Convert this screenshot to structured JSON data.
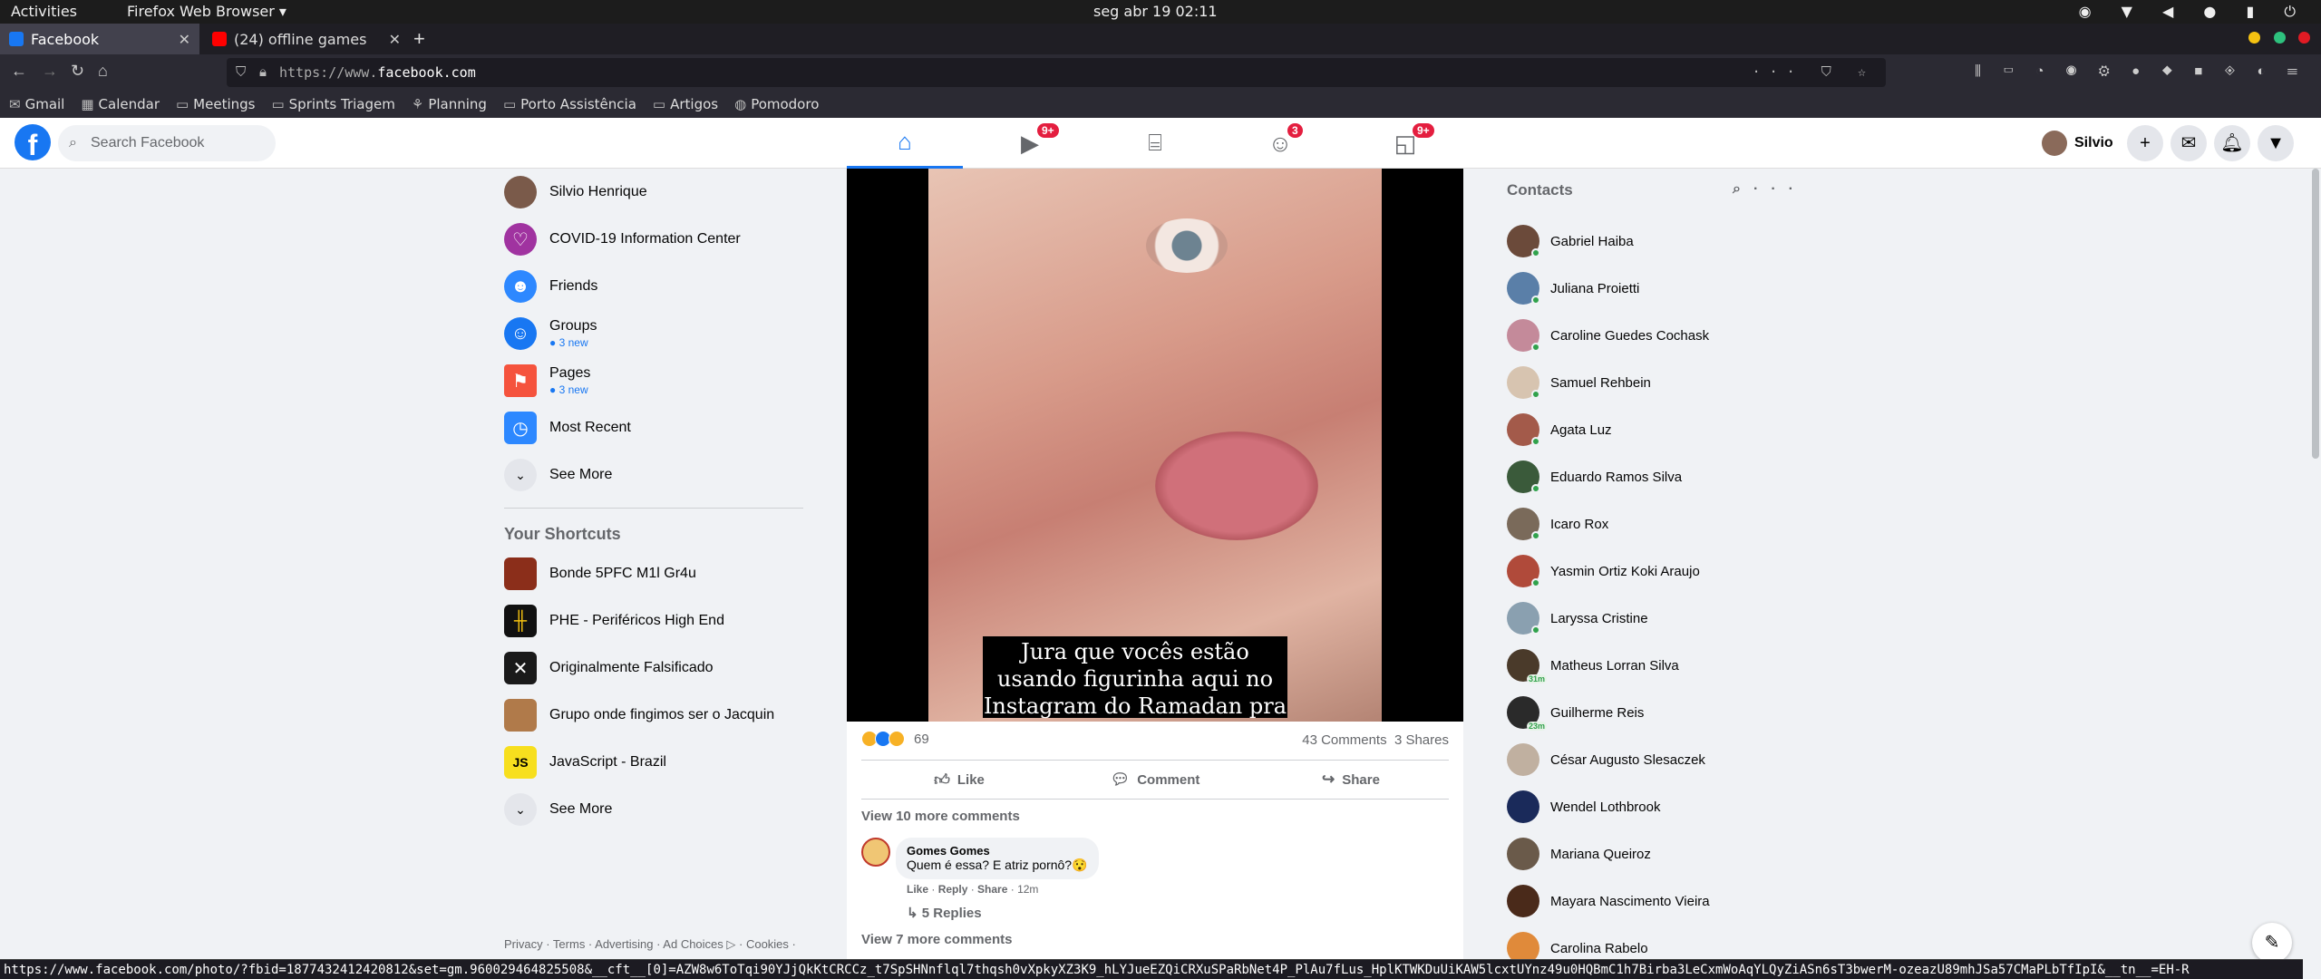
{
  "system": {
    "activities": "Activities",
    "app_menu": "Firefox Web Browser ▾",
    "clock": "seg abr 19  02:11",
    "tray_icons": [
      "record-icon",
      "wifi-icon",
      "volume-icon",
      "mic-icon",
      "battery-icon",
      "power-icon"
    ]
  },
  "browser": {
    "tabs": [
      {
        "label": "Facebook",
        "active": true,
        "favicon_color": "#1877f2"
      },
      {
        "label": "(24) offline games",
        "active": false,
        "favicon_color": "#ff0000"
      }
    ],
    "new_tab": "+",
    "url_prefix": "https://www.",
    "url_domain": "facebook.com",
    "bookmarks": [
      {
        "label": "Gmail",
        "icon": "gmail-icon"
      },
      {
        "label": "Calendar",
        "icon": "calendar-icon"
      },
      {
        "label": "Meetings",
        "icon": "folder-icon"
      },
      {
        "label": "Sprints Triagem",
        "icon": "folder-icon"
      },
      {
        "label": "Planning",
        "icon": "planning-icon"
      },
      {
        "label": "Porto Assistência",
        "icon": "folder-icon"
      },
      {
        "label": "Artigos",
        "icon": "folder-icon"
      },
      {
        "label": "Pomodoro",
        "icon": "globe-icon"
      }
    ],
    "status_url": "https://www.facebook.com/photo/?fbid=1877432412420812&set=gm.960029464825508&__cft__[0]=AZW8w6ToTqi90YJjQkKtCRCCz_t7SpSHNnflql7thqsh0vXpkyXZ3K9_hLYJueEZQiCRXuSPaRbNet4P_PlAu7fLus_HplKTWKDuUiKAW5lcxtUYnz49u0HQBmC1h7Birba3LeCxmWoAqYLQyZiASn6sT3bwerM-ozeazU89mhJSa57CMaPLbTfIpI&__tn__=EH-R"
  },
  "fb_header": {
    "search_placeholder": "Search Facebook",
    "nav": [
      {
        "name": "home",
        "icon": "home-icon",
        "badge": "",
        "active": true
      },
      {
        "name": "watch",
        "icon": "video-icon",
        "badge": "9+",
        "active": false
      },
      {
        "name": "marketplace",
        "icon": "store-icon",
        "badge": "",
        "active": false
      },
      {
        "name": "groups",
        "icon": "groups-icon",
        "badge": "3",
        "active": false
      },
      {
        "name": "gaming",
        "icon": "gaming-icon",
        "badge": "9+",
        "active": false
      }
    ],
    "profile_name": "Silvio"
  },
  "left_menu": {
    "items": [
      {
        "label": "Silvio Henrique",
        "sub": "",
        "icon": "avatar"
      },
      {
        "label": "COVID-19 Information Center",
        "sub": "",
        "icon": "covid-icon"
      },
      {
        "label": "Friends",
        "sub": "",
        "icon": "friends-icon"
      },
      {
        "label": "Groups",
        "sub": "3 new",
        "icon": "groups-icon"
      },
      {
        "label": "Pages",
        "sub": "3 new",
        "icon": "flag-icon"
      },
      {
        "label": "Most Recent",
        "sub": "",
        "icon": "clock-icon"
      },
      {
        "label": "See More",
        "sub": "",
        "icon": "chevron-down-icon"
      }
    ],
    "shortcuts_title": "Your Shortcuts",
    "shortcuts": [
      {
        "label": "Bonde 5PFC M1l Gr4u",
        "color": "#8b2e1a"
      },
      {
        "label": "PHE - Periféricos High End",
        "color": "#111111"
      },
      {
        "label": "Originalmente Falsificado",
        "color": "#1a1a1a"
      },
      {
        "label": "Grupo onde fingimos ser o Jacquin",
        "color": "#b07a4a"
      },
      {
        "label": "JavaScript - Brazil",
        "color": "#f7df1e"
      }
    ],
    "shortcuts_see_more": "See More",
    "footer": "Privacy · Terms · Advertising · Ad Choices ▷ · Cookies ·"
  },
  "post": {
    "caption": "Jura que vocês estão usando figurinha aqui no Instagram do Ramadan pra",
    "reaction_count": "69",
    "comments_count": "43 Comments",
    "shares_count": "3 Shares",
    "actions": {
      "like": "Like",
      "comment": "Comment",
      "share": "Share"
    },
    "view_more_top": "View 10 more comments",
    "comment": {
      "author": "Gomes Gomes",
      "text": "Quem é essa? E atriz pornô?😯",
      "like": "Like",
      "reply": "Reply",
      "share": "Share",
      "time": "12m",
      "replies": "5 Replies"
    },
    "view_more_bottom": "View 7 more comments"
  },
  "contacts": {
    "title": "Contacts",
    "people": [
      {
        "name": "Gabriel Haiba",
        "status": "online",
        "color": "#6b4a3a"
      },
      {
        "name": "Juliana Proietti",
        "status": "online",
        "color": "#5a7fa8"
      },
      {
        "name": "Caroline Guedes Cochask",
        "status": "online",
        "color": "#c48a9a"
      },
      {
        "name": "Samuel Rehbein",
        "status": "online",
        "color": "#d7c4b0"
      },
      {
        "name": "Agata Luz",
        "status": "online",
        "color": "#a35a4a"
      },
      {
        "name": "Eduardo Ramos Silva",
        "status": "online",
        "color": "#3a5a3a"
      },
      {
        "name": "Icaro Rox",
        "status": "online",
        "color": "#7a6a5a"
      },
      {
        "name": "Yasmin Ortiz Koki Araujo",
        "status": "online",
        "color": "#b04a3a"
      },
      {
        "name": "Laryssa Cristine",
        "status": "online",
        "color": "#8aa0b0"
      },
      {
        "name": "Matheus Lorran Silva",
        "status": "31m",
        "color": "#4a3a2a"
      },
      {
        "name": "Guilherme Reis",
        "status": "23m",
        "color": "#2a2a2a"
      },
      {
        "name": "César Augusto Slesaczek",
        "status": "",
        "color": "#c0b0a0"
      },
      {
        "name": "Wendel Lothbrook",
        "status": "",
        "color": "#1a2a5a"
      },
      {
        "name": "Mariana Queiroz",
        "status": "",
        "color": "#6a5a4a"
      },
      {
        "name": "Mayara Nascimento Vieira",
        "status": "",
        "color": "#4a2a1a"
      },
      {
        "name": "Carolina Rabelo",
        "status": "",
        "color": "#e08a3a"
      }
    ]
  }
}
